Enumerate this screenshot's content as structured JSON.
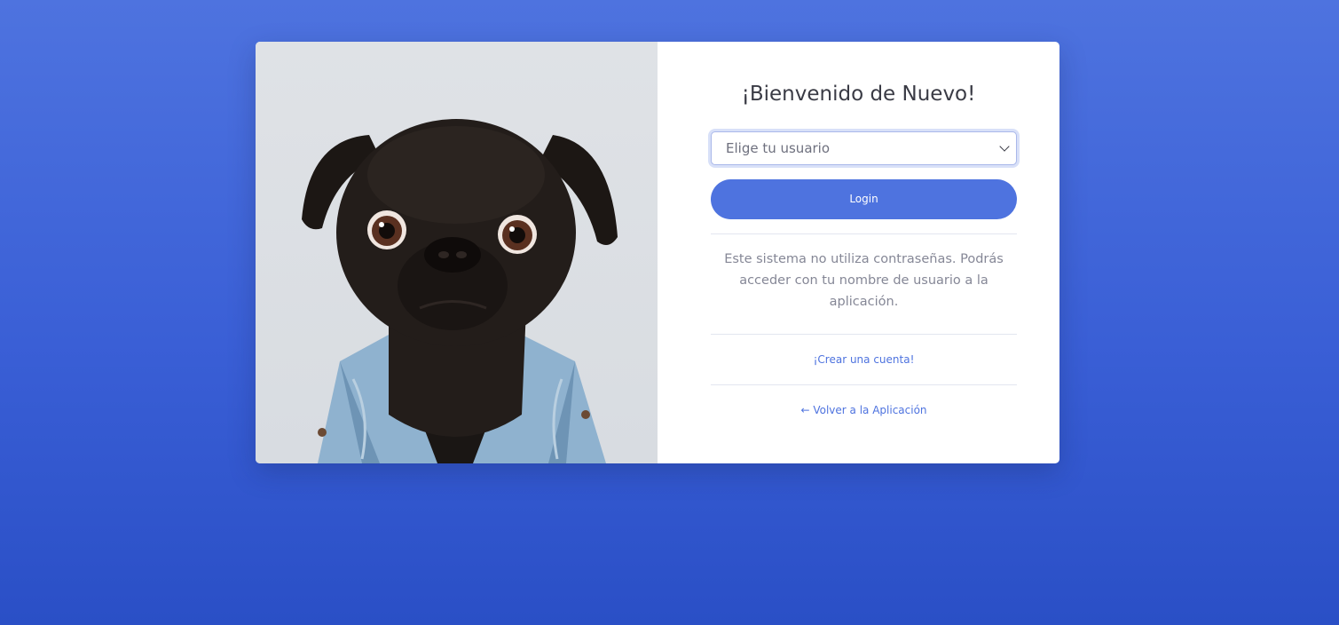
{
  "colors": {
    "background_top": "#4e73df",
    "background_bottom": "#2a4fc6",
    "primary": "#4e73df",
    "text_dark": "#3a3b45",
    "text_muted": "#858796",
    "divider": "#e3e6f0"
  },
  "login": {
    "title": "¡Bienvenido de Nuevo!",
    "user_select": {
      "selected": "Elige tu usuario"
    },
    "login_button": "Login",
    "note": "Este sistema no utiliza contraseñas. Podrás acceder con tu nombre de usuario a la aplicación.",
    "create_account_link": "¡Crear una cuenta!",
    "back_link": "← Volver a la Aplicación"
  },
  "image": {
    "subject": "pug-in-denim-jacket"
  }
}
